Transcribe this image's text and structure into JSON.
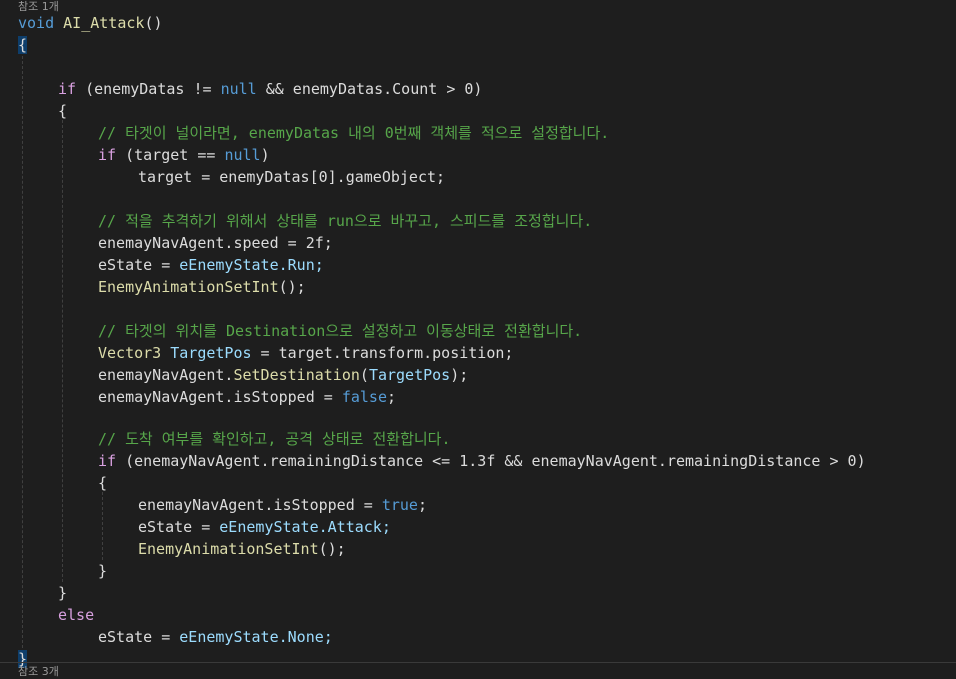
{
  "ref_top": "참조 1개",
  "ref_bottom": "참조 3개",
  "signature": {
    "kw": "void",
    "name": "AI_Attack",
    "parens": "()"
  },
  "code": {
    "if1_kw": "if",
    "if1_a": " (enemyDatas != ",
    "null1": "null",
    "if1_b": " && enemyDatas.Count > 0)",
    "comment1": "// 타겟이 널이라면, enemyDatas 내의 0번째 객체를 적으로 설정합니다.",
    "if2_kw": "if",
    "if2_a": " (target == ",
    "null2": "null",
    "if2_b": ")",
    "assign_target": "target = enemyDatas[0].gameObject;",
    "comment2": "// 적을 추격하기 위해서 상태를 run으로 바꾸고, 스피드를 조정합니다.",
    "speed_line": "enemayNavAgent.speed = 2f;",
    "state_a": "eState = ",
    "state_run": "eEnemyState.Run;",
    "anim_call": "EnemyAnimationSetInt",
    "anim_tail": "();",
    "comment3": "// 타겟의 위치를 Destination으로 설정하고 이동상태로 전환합니다.",
    "vec_type": "Vector3",
    "vec_var": "TargetPos",
    "vec_rest": " = target.transform.position;",
    "dest_a": "enemayNavAgent.",
    "dest_method": "SetDestination",
    "dest_b": "(",
    "dest_arg": "TargetPos",
    "dest_c": ");",
    "stop_a": "enemayNavAgent.isStopped = ",
    "false_kw": "false",
    "semi": ";",
    "comment4": "// 도착 여부를 확인하고, 공격 상태로 전환합니다.",
    "if3_kw": "if",
    "if3_text": " (enemayNavAgent.remainingDistance <= 1.3f && enemayNavAgent.remainingDistance > 0)",
    "stop2_a": "enemayNavAgent.isStopped = ",
    "true_kw": "true",
    "state_b": "eState = ",
    "state_attack": "eEnemyState.Attack;",
    "anim_call2": "EnemyAnimationSetInt",
    "anim_tail2": "();",
    "else_kw": "else",
    "state_c": "eState = ",
    "state_none": "eEnemyState.None;",
    "open_brace": "{",
    "close_brace": "}"
  },
  "colors": {
    "background": "#1e1e1e",
    "keyword": "#569cd6",
    "control": "#d8a0df",
    "comment": "#57a64a",
    "type": "#4ec9b0",
    "method": "#dcdcaa",
    "parameter": "#9cdcfe"
  }
}
